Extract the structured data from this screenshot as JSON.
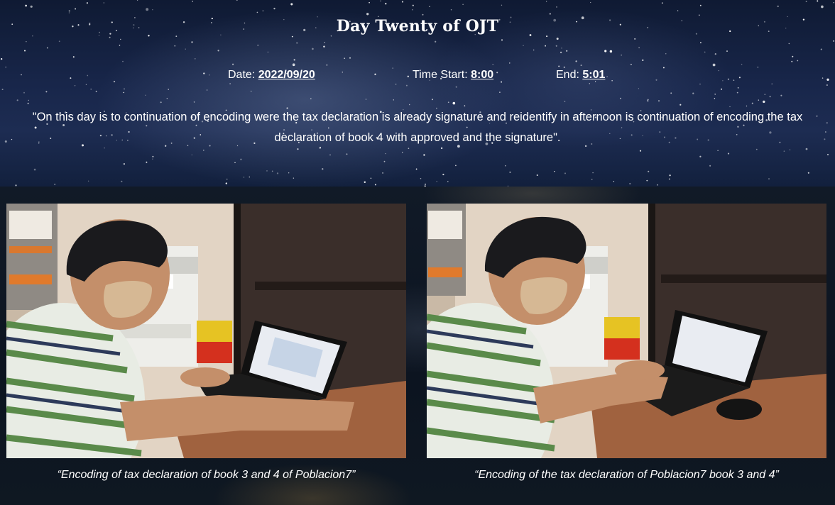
{
  "page": {
    "title": "Day Twenty of OJT",
    "date_label": "Date:",
    "date_value": "2022/09/20",
    "time_start_label": "Time Start:",
    "time_start_value": "8:00",
    "end_label": "End:",
    "end_value": "5:01",
    "description": "\"On this day is to continuation of encoding were the tax declaration is already signature and reidentify in afternoon is continuation of encoding the tax declaration of book 4 with approved and the signature\"."
  },
  "photos": [
    {
      "caption": "“Encoding of tax declaration of book 3 and 4 of Poblacion7”",
      "icon": "photo-person-at-laptop"
    },
    {
      "caption": "“Encoding of the tax declaration of Poblacion7 book 3 and 4”",
      "icon": "photo-person-at-laptop"
    }
  ],
  "colors": {
    "text": "#ffffff",
    "header_bg": "#18264a",
    "lower_bg": "#0c1420"
  }
}
